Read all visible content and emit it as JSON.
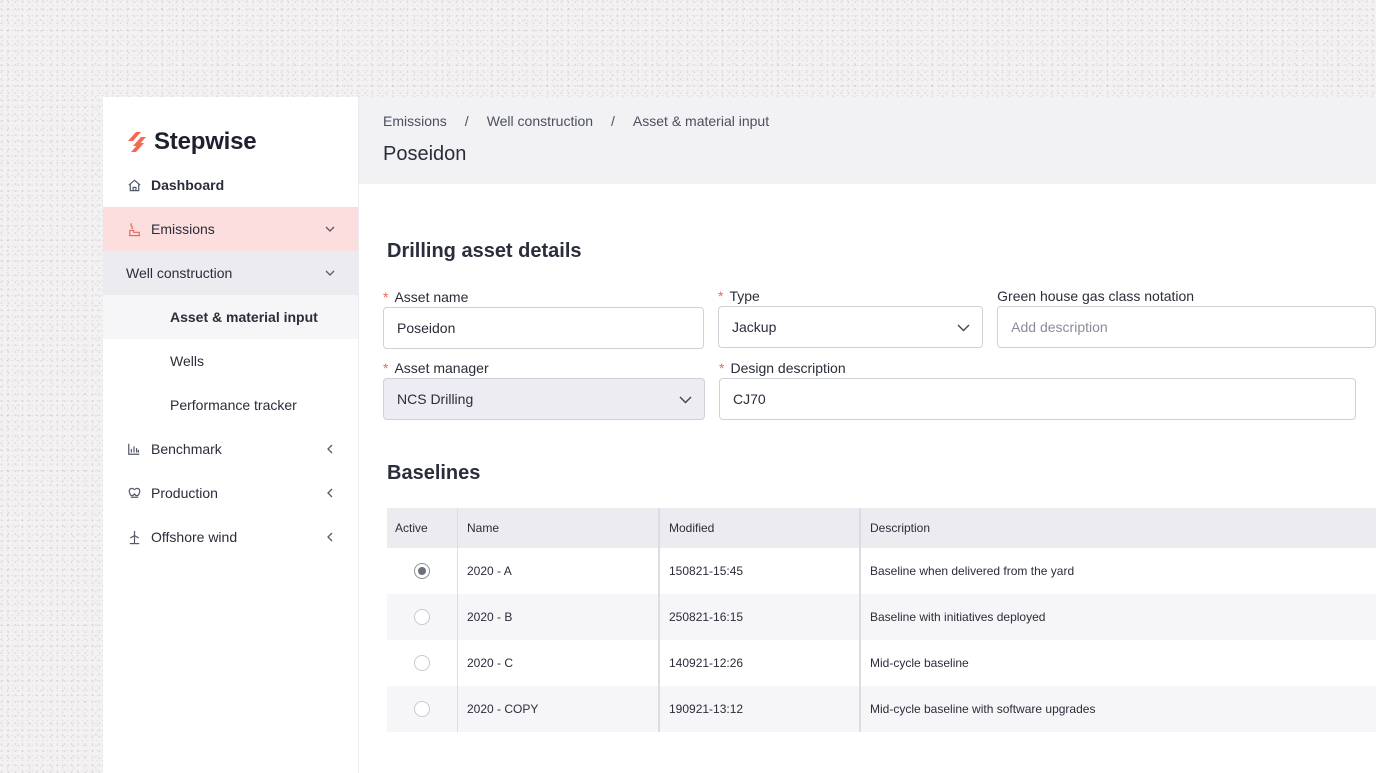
{
  "app": {
    "name": "Stepwise"
  },
  "sidebar": {
    "items": [
      {
        "label": "Dashboard",
        "icon": "home-icon"
      },
      {
        "label": "Emissions",
        "icon": "factory-icon"
      },
      {
        "label": "Well construction"
      },
      {
        "label": "Asset & material input"
      },
      {
        "label": "Wells"
      },
      {
        "label": "Performance tracker"
      },
      {
        "label": "Benchmark",
        "icon": "bar-chart-icon"
      },
      {
        "label": "Production",
        "icon": "production-icon"
      },
      {
        "label": "Offshore wind",
        "icon": "wind-turbine-icon"
      }
    ]
  },
  "header": {
    "breadcrumb": [
      "Emissions",
      "Well construction",
      "Asset & material input"
    ],
    "separator": "/",
    "title": "Poseidon"
  },
  "asset": {
    "section_title": "Drilling asset details",
    "asset_name": {
      "label": "Asset name",
      "value": "Poseidon"
    },
    "type": {
      "label": "Type",
      "value": "Jackup"
    },
    "ghg": {
      "label": "Green house gas class notation",
      "placeholder": "Add description"
    },
    "manager": {
      "label": "Asset manager",
      "value": "NCS Drilling"
    },
    "design": {
      "label": "Design description",
      "value": "CJ70"
    },
    "required_mark": "*"
  },
  "baselines": {
    "section_title": "Baselines",
    "columns": [
      "Active",
      "Name",
      "Modified",
      "Description"
    ],
    "rows": [
      {
        "active": true,
        "name": "2020 - A",
        "modified": "150821-15:45",
        "description": "Baseline when delivered from the yard"
      },
      {
        "active": false,
        "name": "2020 - B",
        "modified": "250821-16:15",
        "description": "Baseline with initiatives deployed"
      },
      {
        "active": false,
        "name": "2020 - C",
        "modified": "140921-12:26",
        "description": "Mid-cycle baseline"
      },
      {
        "active": false,
        "name": "2020 - COPY",
        "modified": "190921-13:12",
        "description": "Mid-cycle baseline with software upgrades"
      }
    ]
  },
  "colors": {
    "accent": "#f06a55",
    "emissions_bg": "#fbdedd",
    "header_bg": "#f2f2f5"
  }
}
